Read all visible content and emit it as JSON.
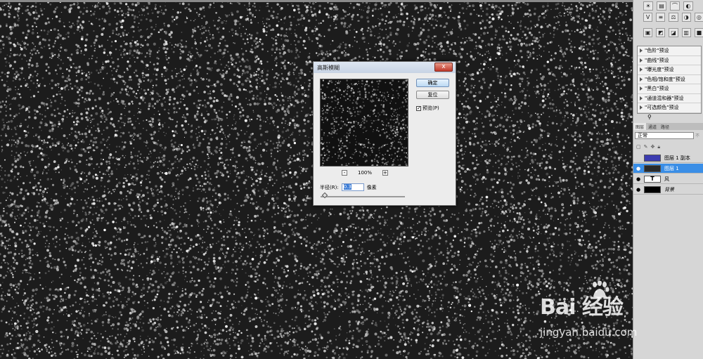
{
  "dialog": {
    "title": "高斯模糊",
    "close_label": "x",
    "ok_label": "确定",
    "reset_label": "复位",
    "preview_label": "预览(P)",
    "preview_checked": true,
    "zoom": {
      "minus_label": "-",
      "value": "100%",
      "plus_label": "+"
    },
    "radius": {
      "label": "半径(R):",
      "value": "0.3",
      "unit": "像素"
    }
  },
  "presets": [
    "\"色阶\"预设",
    "\"曲线\"预设",
    "\"曝光度\"预设",
    "\"色相/饱和度\"预设",
    "\"黑白\"预设",
    "\"通道混和器\"预设",
    "\"可选颜色\"预设"
  ],
  "layers_panel": {
    "tabs": [
      "图层",
      "通道",
      "路径"
    ],
    "blend_mode": "正常",
    "opacity_label": "不",
    "layers": [
      {
        "name": "图层 1 副本",
        "thumb_color": "#3b3bb0",
        "visible": false,
        "selected": false
      },
      {
        "name": "图层 1",
        "thumb_color": "#2a2a2a",
        "visible": true,
        "selected": true
      },
      {
        "name": "风",
        "thumb_color": "#ffffff",
        "visible": true,
        "selected": false,
        "type_layer": true
      },
      {
        "name": "背景",
        "thumb_color": "#000000",
        "visible": true,
        "selected": false
      }
    ]
  },
  "watermark": {
    "logo": "Bai 经验",
    "url": "jingyan.baidu.com"
  },
  "colors": {
    "accent": "#3a8ee6",
    "canvas": "#1c1c1c"
  }
}
